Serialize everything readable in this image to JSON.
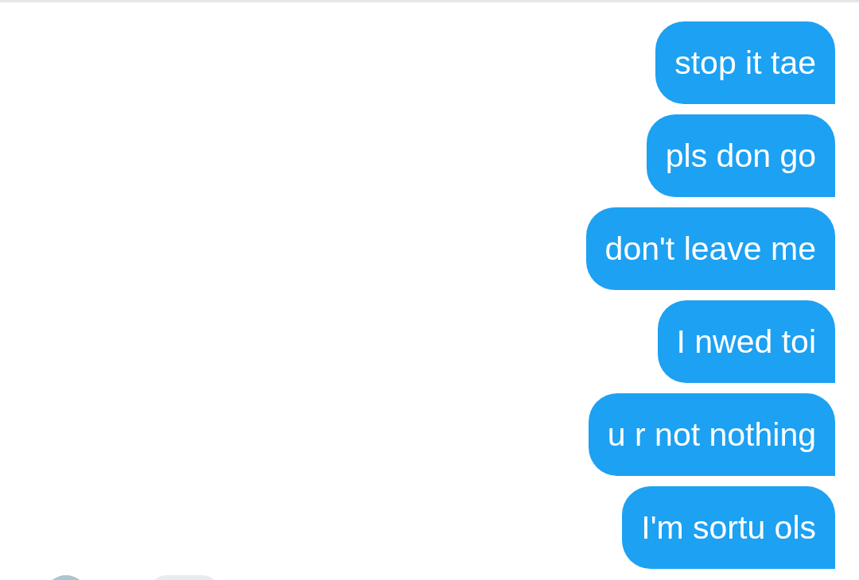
{
  "messages": [
    {
      "text": "stop it tae",
      "kind": "outgoing"
    },
    {
      "text": "pls don go",
      "kind": "outgoing"
    },
    {
      "text": "don't leave me",
      "kind": "outgoing"
    },
    {
      "text": "I nwed toi",
      "kind": "outgoing"
    },
    {
      "text": "u r not nothing",
      "kind": "outgoing"
    },
    {
      "text": "I'm sortu ols",
      "kind": "outgoing"
    }
  ]
}
